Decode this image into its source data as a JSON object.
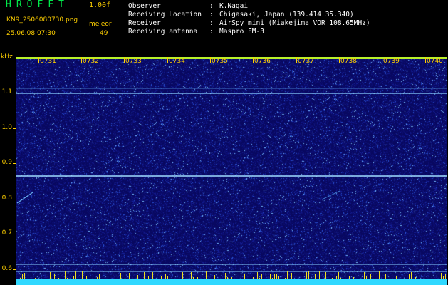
{
  "header": {
    "app_title": "HROFFT",
    "version": "1.00f",
    "file_name": "KN9_2506080730.png",
    "mode": "meleor",
    "datetime": "25.06.08 07:30",
    "count": "49"
  },
  "station_info": [
    {
      "key": "Observer",
      "sep": ":",
      "value": "K.Nagai"
    },
    {
      "key": "Receiving Location",
      "sep": ":",
      "value": "Chigasaki, Japan (139.414 35.340)"
    },
    {
      "key": "Receiver",
      "sep": ":",
      "value": "AirSpy mini (Miakejima VOR 108.65MHz)"
    },
    {
      "key": "Receiving antenna",
      "sep": ":",
      "value": "Maspro FM-3"
    }
  ],
  "spectrogram": {
    "y_unit": "kHz",
    "y_labels": [
      "1.1",
      "1.0",
      "0.9",
      "0.8",
      "0.7",
      "0.6"
    ],
    "x_labels": [
      "0731",
      "0732",
      "0733",
      "0734",
      "0735",
      "0736",
      "0737",
      "0738",
      "0739",
      "0740"
    ],
    "colors": {
      "background": "#080860",
      "label": "#ffd000",
      "carrier": "#9fdcff",
      "baseline": "#30d8ff"
    }
  }
}
